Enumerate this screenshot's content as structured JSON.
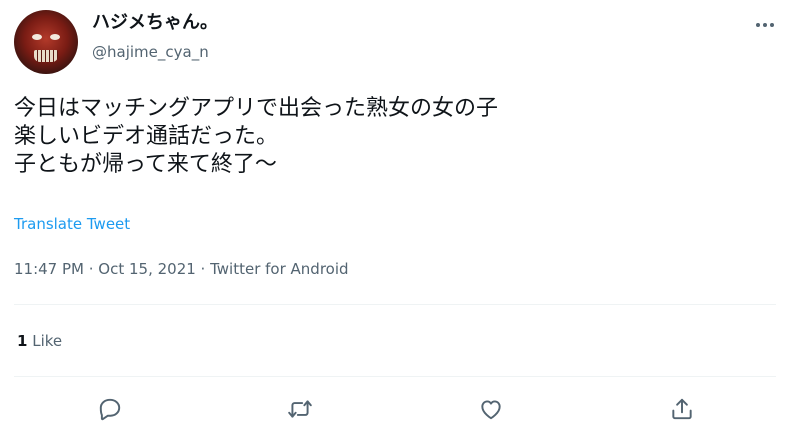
{
  "tweet": {
    "author": {
      "display_name": "ハジメちゃん。",
      "handle": "@hajime_cya_n"
    },
    "text_lines": [
      "今日はマッチングアプリで出会った熟女の女の子",
      "楽しいビデオ通話だった。",
      "子ともが帰って来て終了〜"
    ],
    "translate_label": "Translate Tweet",
    "timestamp": "11:47 PM · Oct 15, 2021 · Twitter for Android",
    "likes": {
      "count": "1",
      "label": "Like"
    }
  },
  "icons": {
    "more": "more-horizontal-icon",
    "reply": "reply-icon",
    "retweet": "retweet-icon",
    "like": "heart-icon",
    "share": "share-icon"
  },
  "colors": {
    "text": "#0f1419",
    "secondary": "#536471",
    "link": "#1d9bf0",
    "divider": "#eff3f4"
  }
}
